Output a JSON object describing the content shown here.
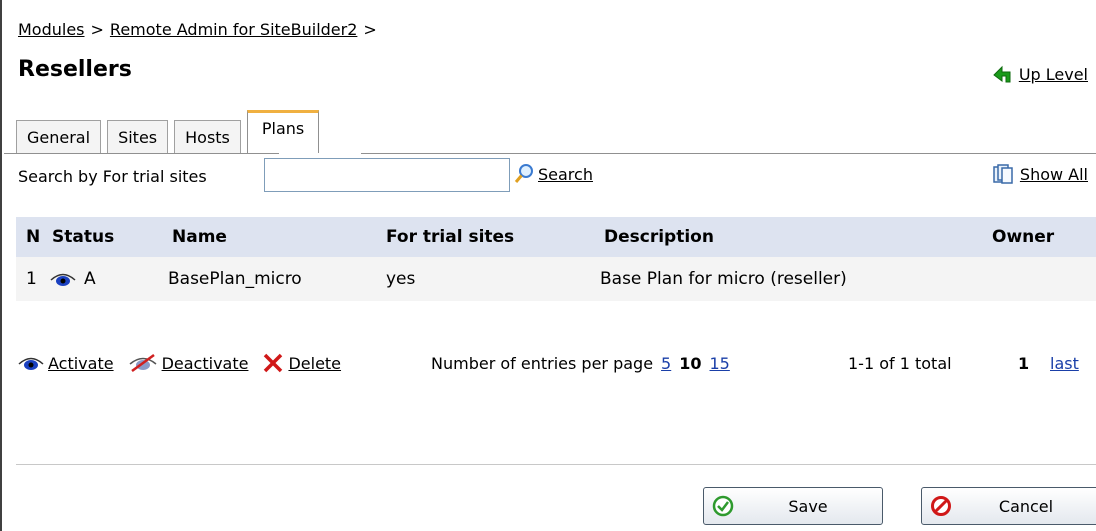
{
  "breadcrumb": {
    "items": [
      "Modules",
      "Remote Admin for SiteBuilder2"
    ],
    "separator": ">"
  },
  "page": {
    "title": "Resellers",
    "up_level_label": "Up Level"
  },
  "tabs": [
    {
      "label": "General",
      "active": false
    },
    {
      "label": "Sites",
      "active": false
    },
    {
      "label": "Hosts",
      "active": false
    },
    {
      "label": "Plans",
      "active": true
    }
  ],
  "search": {
    "label": "Search by For trial sites",
    "value": "",
    "button_label": "Search",
    "show_all_label": "Show All"
  },
  "table": {
    "columns": [
      "N",
      "Status",
      "Name",
      "For trial sites",
      "Description",
      "Owner"
    ],
    "rows": [
      {
        "n": "1",
        "status": "A",
        "name": "BasePlan_micro",
        "trial": "yes",
        "description": "Base Plan for micro (reseller)",
        "owner": ""
      }
    ]
  },
  "actions": {
    "activate": "Activate",
    "deactivate": "Deactivate",
    "delete": "Delete"
  },
  "paging": {
    "per_page_label": "Number of entries per page",
    "option_5": "5",
    "option_10": "10",
    "option_15": "15",
    "total": "1-1 of 1 total",
    "current": "1",
    "last": "last"
  },
  "buttons": {
    "save": "Save",
    "cancel": "Cancel"
  },
  "colors": {
    "header_bg": "#dde3f0",
    "row_bg": "#f4f4f4",
    "link_blue": "#1a3fa8",
    "tab_accent": "#f0b040",
    "ok_green": "#2e9a2e",
    "cancel_red": "#d01818"
  }
}
